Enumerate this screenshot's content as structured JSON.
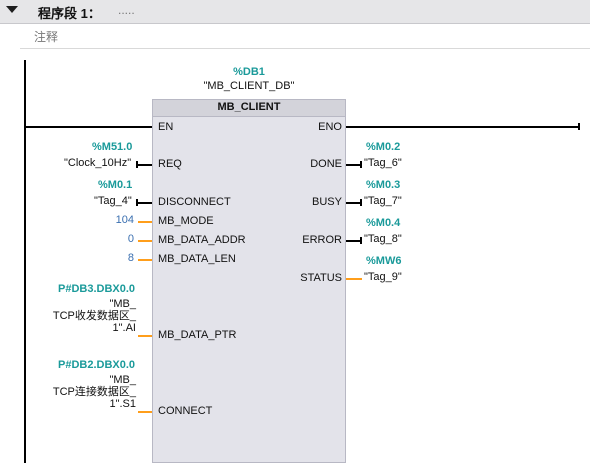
{
  "header": {
    "title": "程序段 1：",
    "dots": "....."
  },
  "comment_label": "注释",
  "block": {
    "db_address": "%DB1",
    "db_name": "\"MB_CLIENT_DB\"",
    "type": "MB_CLIENT"
  },
  "pins": {
    "en": "EN",
    "eno": "ENO",
    "req": "REQ",
    "disconnect": "DISCONNECT",
    "mb_mode": "MB_MODE",
    "mb_data_addr": "MB_DATA_ADDR",
    "mb_data_len": "MB_DATA_LEN",
    "mb_data_ptr": "MB_DATA_PTR",
    "connect": "CONNECT",
    "done": "DONE",
    "busy": "BUSY",
    "error": "ERROR",
    "status": "STATUS"
  },
  "inputs": {
    "req_addr": "%M51.0",
    "req_tag": "\"Clock_10Hz\"",
    "disconnect_addr": "%M0.1",
    "disconnect_tag": "\"Tag_4\"",
    "mb_mode_value": "104",
    "mb_data_addr_value": "0",
    "mb_data_len_value": "8",
    "ptr_addr": "P#DB3.DBX0.0",
    "ptr_tag_l1": "\"MB_",
    "ptr_tag_l2": "TCP收发数据区_",
    "ptr_tag_l3": "1\".AI",
    "connect_addr": "P#DB2.DBX0.0",
    "connect_tag_l1": "\"MB_",
    "connect_tag_l2": "TCP连接数据区_",
    "connect_tag_l3": "1\".S1"
  },
  "outputs": {
    "done_addr": "%M0.2",
    "done_tag": "\"Tag_6\"",
    "busy_addr": "%M0.3",
    "busy_tag": "\"Tag_7\"",
    "error_addr": "%M0.4",
    "error_tag": "\"Tag_8\"",
    "status_addr": "%MW6",
    "status_tag": "\"Tag_9\""
  }
}
